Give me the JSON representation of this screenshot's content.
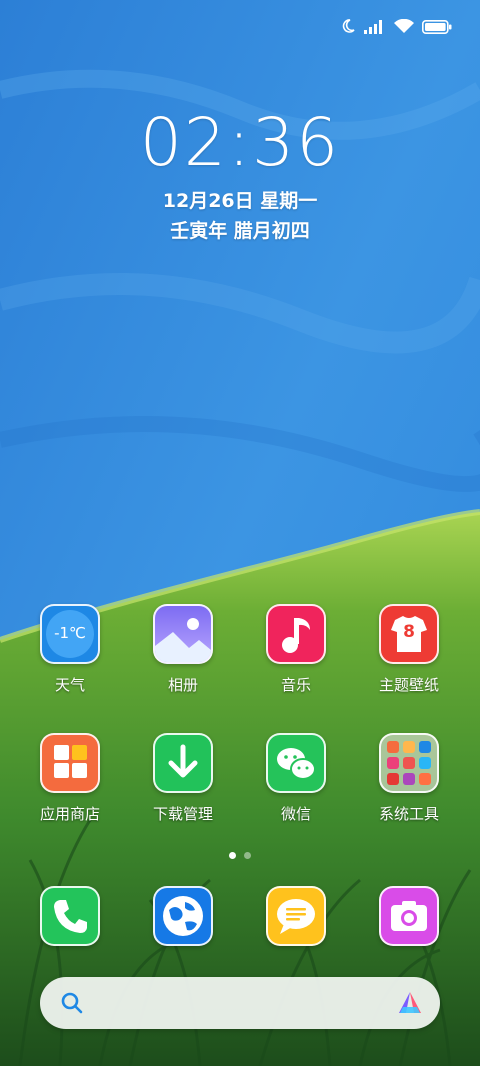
{
  "status_bar": {
    "icons": [
      "moon-icon",
      "signal-icon",
      "wifi-icon",
      "battery-icon"
    ]
  },
  "lockclock": {
    "time": "02:36",
    "date": "12月26日 星期一",
    "lunar": "壬寅年 腊月初四"
  },
  "weather_widget": {
    "temp": "-1℃"
  },
  "apps_row1": [
    {
      "label": "天气"
    },
    {
      "label": "相册"
    },
    {
      "label": "音乐"
    },
    {
      "label": "主题壁纸"
    }
  ],
  "theme_icon_number": "8",
  "apps_row2": [
    {
      "label": "应用商店"
    },
    {
      "label": "下载管理"
    },
    {
      "label": "微信"
    },
    {
      "label": "系统工具"
    }
  ],
  "page_indicator": {
    "pages": 2,
    "current": 1
  },
  "dock": [
    "phone-icon",
    "browser-icon",
    "messages-icon",
    "camera-icon"
  ],
  "search_bar": {
    "icons": [
      "search-icon",
      "assistant-logo-icon"
    ]
  },
  "colors": {
    "sky_top": "#2f82d8",
    "grass": "#3d8a2a",
    "weather": "#1e88e5",
    "music": "#f0245c",
    "theme": "#ee3b34",
    "store": "#f46b3e",
    "download": "#22c25a",
    "wechat": "#25c35a",
    "phone": "#23c45b",
    "browser": "#1679e6",
    "messages": "#ffc21d",
    "camera": "#d94ce8"
  }
}
